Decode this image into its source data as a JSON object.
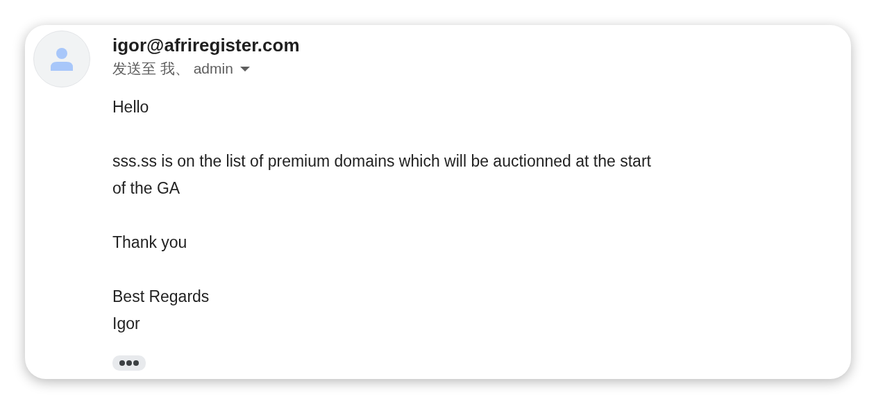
{
  "message": {
    "sender": "igor@afriregister.com",
    "recipients": "发送至 我、 admin",
    "body": [
      [
        "Hello"
      ],
      [
        "sss.ss is on the list of premium domains which will be auctionned at the start of the GA"
      ],
      [
        "Thank you"
      ],
      [
        "Best Regards",
        "Igor"
      ]
    ]
  }
}
